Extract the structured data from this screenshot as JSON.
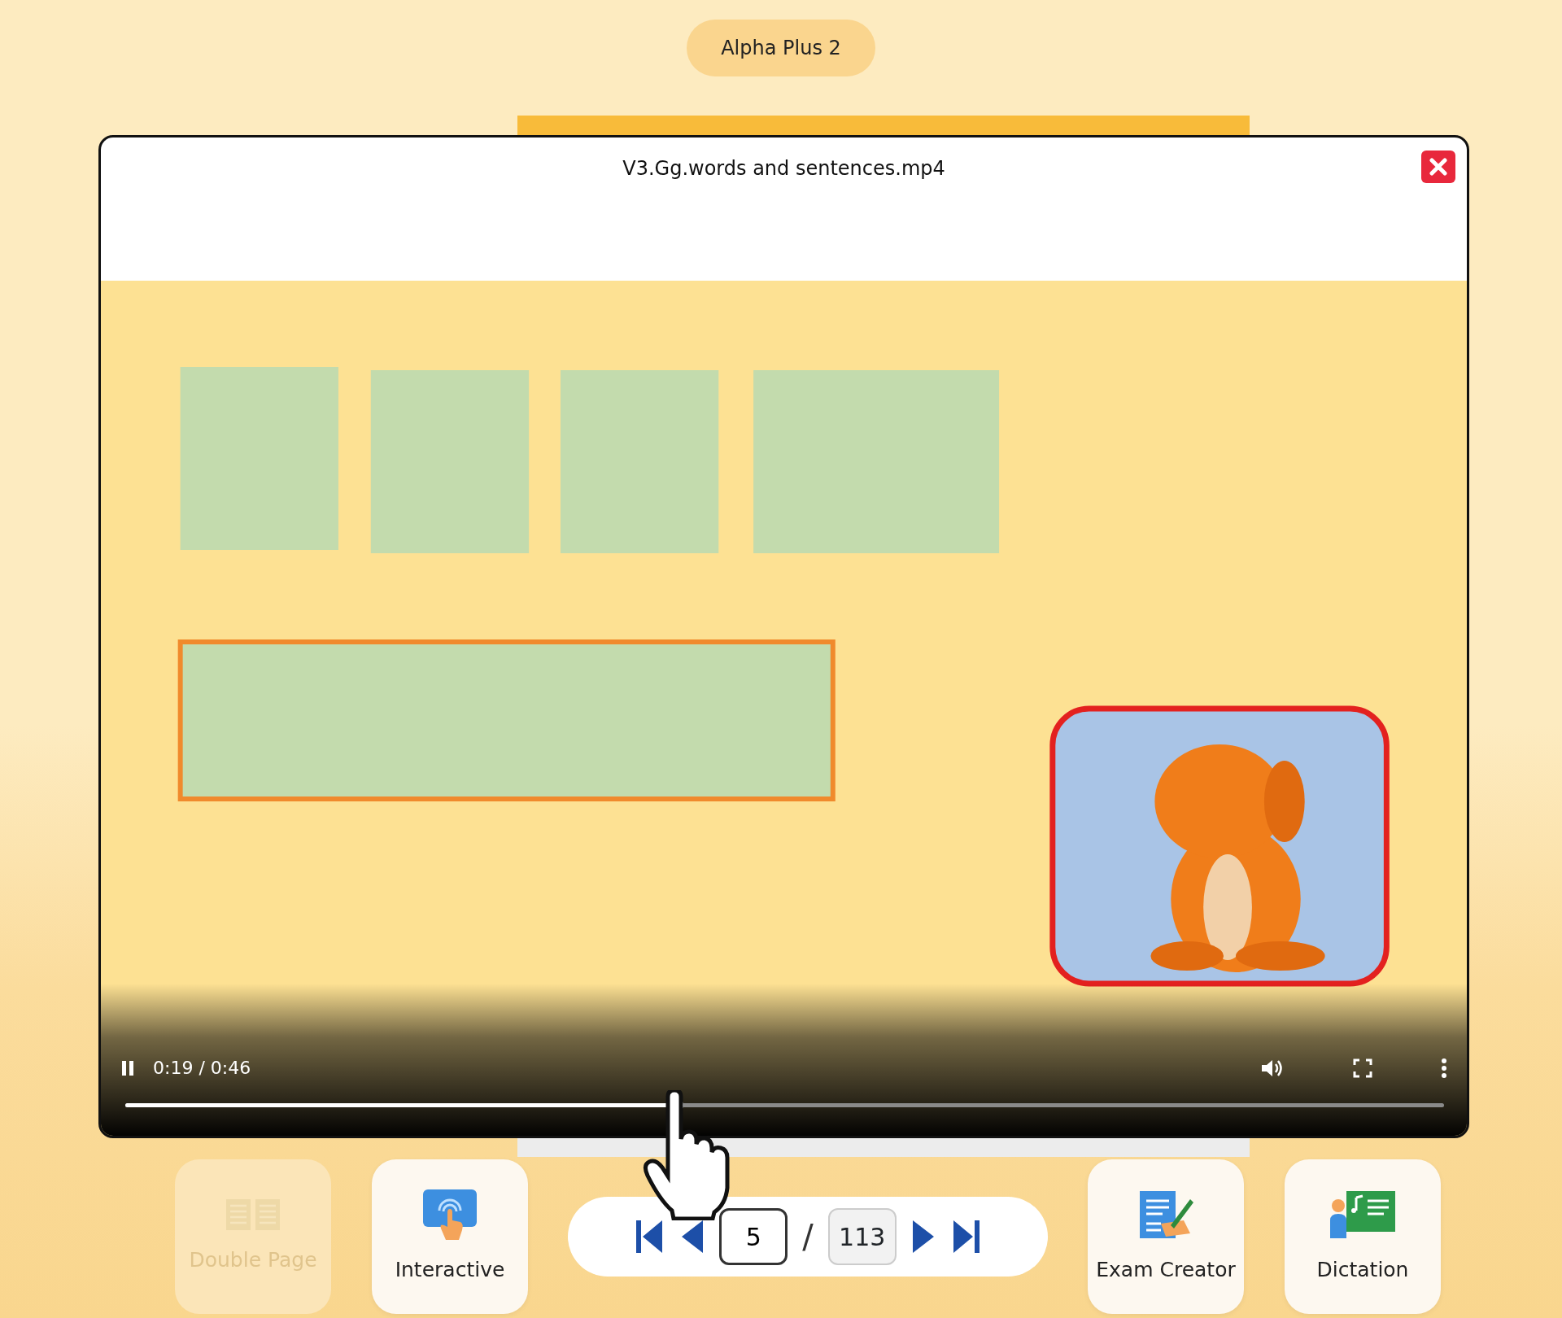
{
  "header": {
    "title": "Alpha Plus 2"
  },
  "video_dialog": {
    "title": "V3.Gg.words and sentences.mp4",
    "player": {
      "playing": true,
      "time": "0:19 / 0:46",
      "level": 0.417
    }
  },
  "toolbar": {
    "left_buttons": [
      {
        "kind": "double-page",
        "label": "Double Page",
        "disabled": true
      },
      {
        "kind": "interactive",
        "label": "Interactive",
        "disabled": false
      }
    ],
    "pager": {
      "page": "5",
      "separator": "/",
      "total": "113"
    },
    "right_buttons": [
      {
        "kind": "exam-creator",
        "label": "Exam Creator",
        "disabled": false
      },
      {
        "kind": "dictation",
        "label": "Dictation",
        "disabled": false
      }
    ]
  }
}
